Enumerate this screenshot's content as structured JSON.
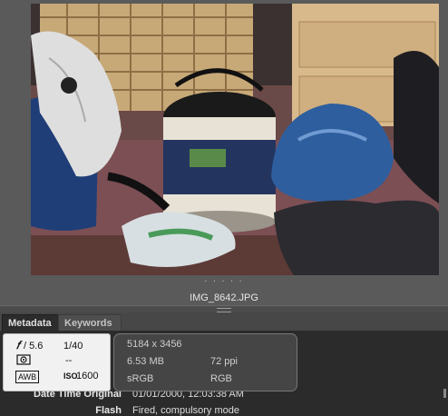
{
  "viewer": {
    "dots": ". . . . .",
    "filename": "IMG_8642.JPG"
  },
  "tabs": [
    {
      "label": "Metadata"
    },
    {
      "label": "Keywords"
    }
  ],
  "exif": {
    "aperture_symbol": "𝑓",
    "aperture": "/ 5.6",
    "shutter": "1/40",
    "metering_icon": "metering-icon",
    "exposure_comp": "--",
    "wb": "AWB",
    "iso_label": "ISO",
    "iso": "1600"
  },
  "file_info": {
    "dimensions": "5184 x 3456",
    "size": "6.53 MB",
    "ppi": "72 ppi",
    "color_profile": "sRGB",
    "color_mode": "RGB"
  },
  "metadata_fields": [
    {
      "label": "Date Time Original",
      "value": "01/01/2000, 12:03:38 AM"
    },
    {
      "label": "Flash",
      "value": "Fired, compulsory mode"
    }
  ],
  "colors": {
    "background": "#5b5b5b",
    "panel": "#2b2b2b",
    "exif_box": "#f1f1f1"
  }
}
